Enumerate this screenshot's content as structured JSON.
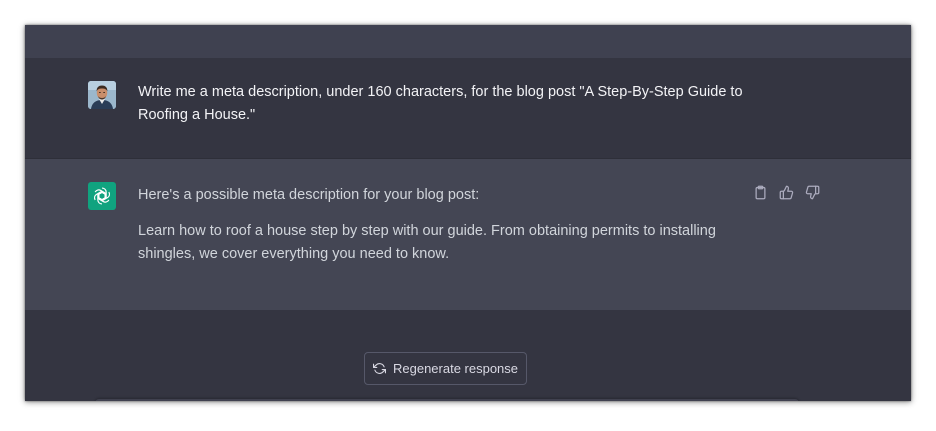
{
  "conversation": {
    "user_message": {
      "text": "Write me a meta description, under 160 characters, for the blog post \"A Step-By-Step Guide to Roofing a House.\""
    },
    "assistant_message": {
      "paragraphs": [
        "Here's a possible meta description for your blog post:",
        "Learn how to roof a house step by step with our guide. From obtaining permits to installing shingles, we cover everything you need to know."
      ],
      "actions": {
        "copy_icon": "clipboard-icon",
        "like_icon": "thumbs-up-icon",
        "dislike_icon": "thumbs-down-icon"
      }
    }
  },
  "footer": {
    "regenerate_label": "Regenerate response",
    "regenerate_icon": "refresh-icon"
  },
  "colors": {
    "background": "#343541",
    "assistant_row": "#444654",
    "brand_green": "#10a37f",
    "text": "#ececf1"
  }
}
